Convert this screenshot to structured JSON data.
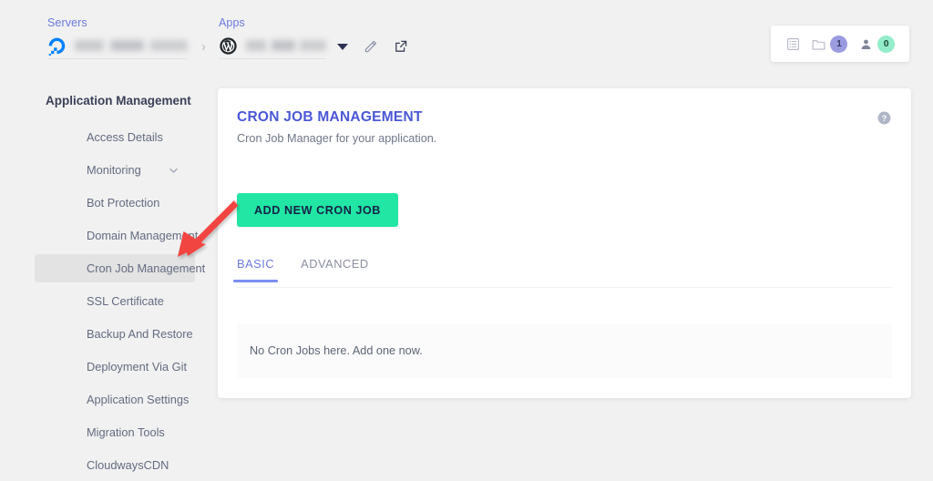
{
  "breadcrumb": {
    "servers": {
      "label": "Servers",
      "logo_icon": "digitalocean-logo-icon",
      "name_redacted": true,
      "separator": "›"
    },
    "apps": {
      "label": "Apps",
      "logo_icon": "wordpress-logo-icon",
      "name_redacted": true,
      "dropdown_icon": "caret-down-icon",
      "edit_icon": "pencil-edit-icon",
      "launch_icon": "external-link-icon"
    }
  },
  "counters": [
    {
      "icon": "server-list-icon",
      "badge": null,
      "badge_color": null
    },
    {
      "icon": "folder-icon",
      "badge": "1",
      "badge_color": "#9b9be0"
    },
    {
      "icon": "user-icon",
      "badge": "0",
      "badge_color": "#93edcb"
    }
  ],
  "sidebar": {
    "title": "Application Management",
    "items": [
      {
        "label": "Access Details",
        "active": false,
        "expandable": false
      },
      {
        "label": "Monitoring",
        "active": false,
        "expandable": true,
        "chevron_icon": "chevron-down-icon"
      },
      {
        "label": "Bot Protection",
        "active": false,
        "expandable": false
      },
      {
        "label": "Domain Management",
        "active": false,
        "expandable": false
      },
      {
        "label": "Cron Job Management",
        "active": true,
        "expandable": false
      },
      {
        "label": "SSL Certificate",
        "active": false,
        "expandable": false
      },
      {
        "label": "Backup And Restore",
        "active": false,
        "expandable": false
      },
      {
        "label": "Deployment Via Git",
        "active": false,
        "expandable": false
      },
      {
        "label": "Application Settings",
        "active": false,
        "expandable": false
      },
      {
        "label": "Migration Tools",
        "active": false,
        "expandable": false
      },
      {
        "label": "CloudwaysCDN",
        "active": false,
        "expandable": false
      }
    ]
  },
  "card": {
    "title": "CRON JOB MANAGEMENT",
    "subtitle": "Cron Job Manager for your application.",
    "help_icon": "help-circle-icon",
    "add_button": "ADD NEW CRON JOB",
    "tabs": [
      {
        "label": "BASIC",
        "active": true
      },
      {
        "label": "ADVANCED",
        "active": false
      }
    ],
    "empty_state": "No Cron Jobs here. Add one now."
  },
  "annotation": {
    "type": "arrow",
    "color": "#f0453f",
    "points_to": "Cron Job Management"
  },
  "colors": {
    "page_background": "#f1f1f1",
    "card_background": "#ffffff",
    "accent_blue": "#4a57d6",
    "link_blue": "#6c7ae0",
    "tab_underline": "#7d8ff2",
    "button_green": "#21e6a4",
    "button_text": "#152246",
    "sidebar_active": "#e3e3e3",
    "text_muted": "#636b80"
  }
}
